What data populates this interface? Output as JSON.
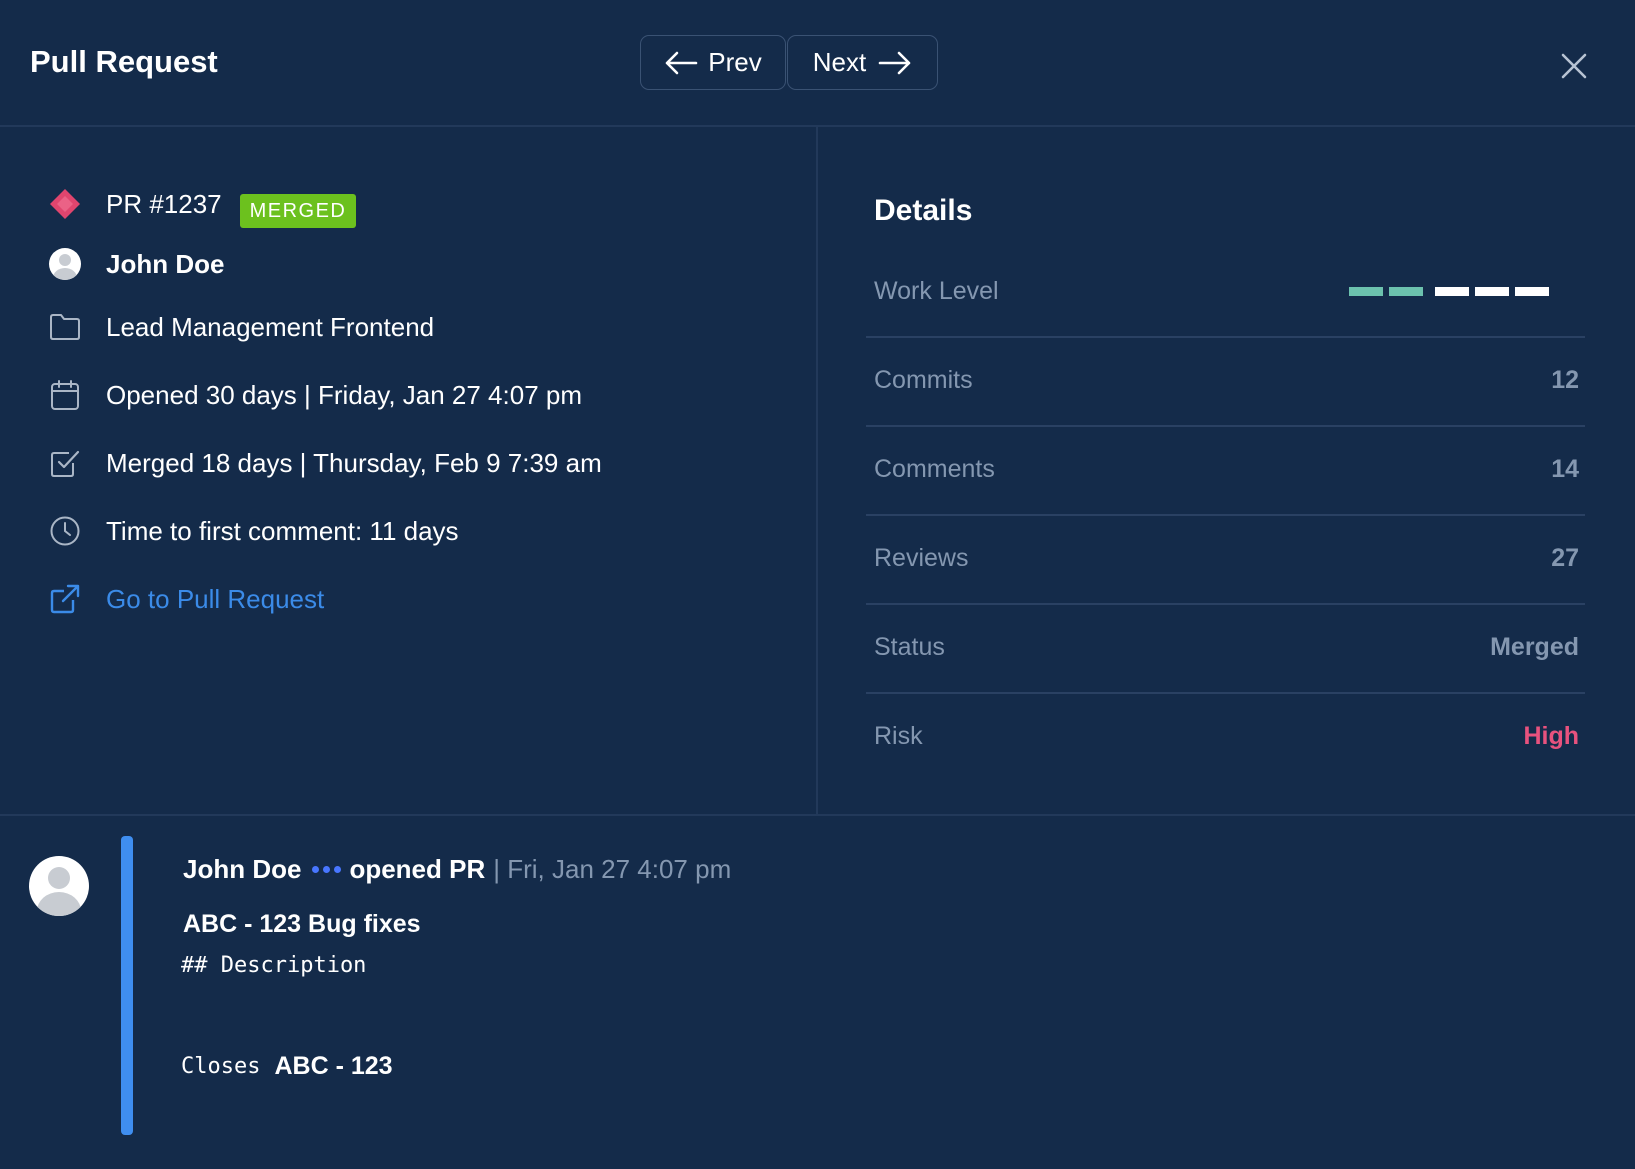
{
  "header": {
    "title": "Pull Request",
    "prev_label": "Prev",
    "next_label": "Next"
  },
  "pr": {
    "number": "PR #1237",
    "badge": "MERGED",
    "author": "John Doe",
    "repo": "Lead Management Frontend",
    "opened": "Opened 30 days | Friday, Jan 27 4:07 pm",
    "merged": "Merged 18 days | Thursday, Feb 9 7:39 am",
    "first_comment": "Time to first comment: 11 days",
    "link_label": "Go to Pull Request"
  },
  "details": {
    "title": "Details",
    "work_level_label": "Work Level",
    "work_level": 2,
    "work_level_max": 5,
    "rows": [
      {
        "label": "Commits",
        "value": "12"
      },
      {
        "label": "Comments",
        "value": "14"
      },
      {
        "label": "Reviews",
        "value": "27"
      },
      {
        "label": "Status",
        "value": "Merged"
      },
      {
        "label": "Risk",
        "value": "High"
      }
    ]
  },
  "comment": {
    "author": "John Doe",
    "action": "opened PR",
    "date": "| Fri, Jan 27 4:07 pm",
    "title": "ABC - 123 Bug fixes",
    "description": "## Description",
    "closes_prefix": "Closes",
    "closes_ref": "ABC - 123"
  },
  "colors": {
    "background": "#142b4a",
    "badge": "#6cc11e",
    "link": "#3b8be8",
    "risk_high": "#e8527e",
    "work_level_filled": "#6cc2ae",
    "work_level_empty": "#ffffff",
    "accent_bar": "#3f8ef0",
    "pr_icon": "#e0456e"
  }
}
